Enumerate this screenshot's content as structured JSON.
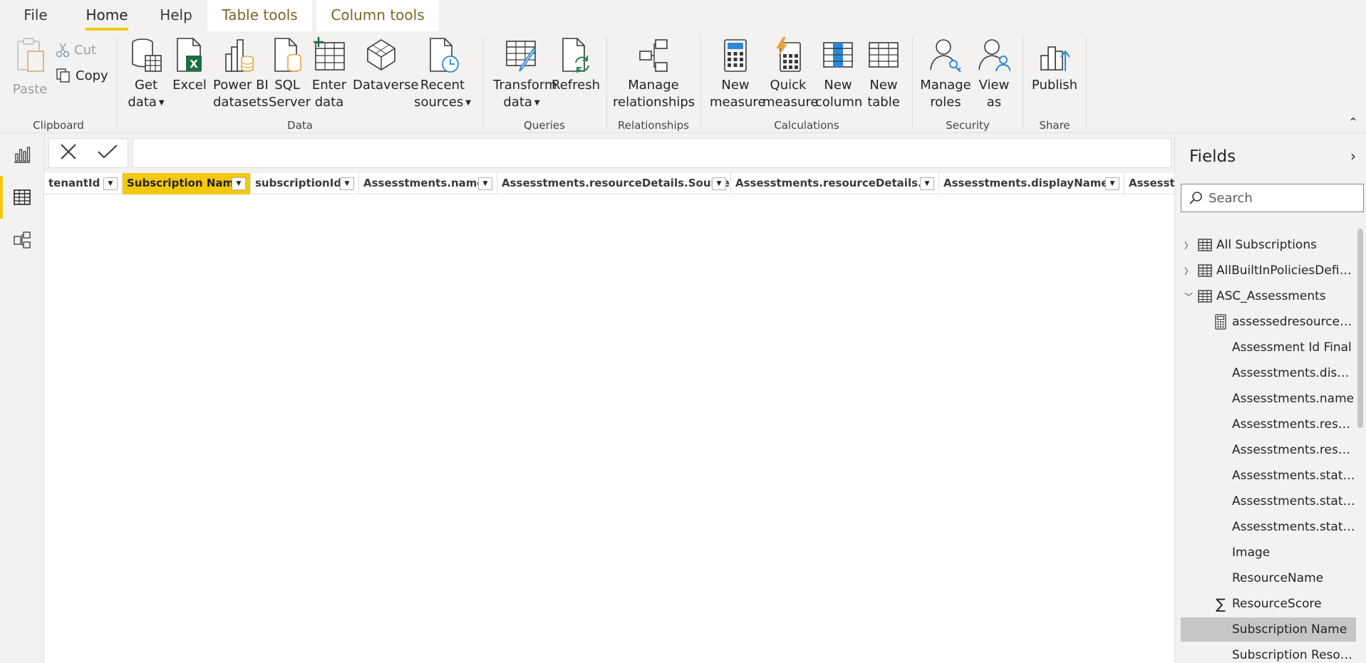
{
  "menu": {
    "file": "File",
    "home": "Home",
    "help": "Help",
    "table_tools": "Table tools",
    "column_tools": "Column tools"
  },
  "ribbon": {
    "clipboard": {
      "label": "Clipboard",
      "paste": "Paste",
      "cut": "Cut",
      "copy": "Copy"
    },
    "data": {
      "label": "Data",
      "get_data": [
        "Get",
        "data"
      ],
      "excel": [
        "Excel"
      ],
      "power_bi": [
        "Power BI",
        "datasets"
      ],
      "sql": [
        "SQL",
        "Server"
      ],
      "enter": [
        "Enter",
        "data"
      ],
      "dataverse": [
        "Dataverse"
      ],
      "recent": [
        "Recent",
        "sources"
      ]
    },
    "queries": {
      "label": "Queries",
      "transform": [
        "Transform",
        "data"
      ],
      "refresh": [
        "Refresh"
      ]
    },
    "relationships": {
      "label": "Relationships",
      "manage": [
        "Manage",
        "relationships"
      ]
    },
    "calculations": {
      "label": "Calculations",
      "new_measure": [
        "New",
        "measure"
      ],
      "quick_measure": [
        "Quick",
        "measure"
      ],
      "new_column": [
        "New",
        "column"
      ],
      "new_table": [
        "New",
        "table"
      ]
    },
    "security": {
      "label": "Security",
      "manage_roles": [
        "Manage",
        "roles"
      ],
      "view_as": [
        "View",
        "as"
      ]
    },
    "share": {
      "label": "Share",
      "publish": [
        "Publish"
      ]
    }
  },
  "formula": {
    "value": ""
  },
  "table": {
    "columns": [
      {
        "name": "tenantId",
        "selected": false
      },
      {
        "name": "Subscription Name",
        "selected": true
      },
      {
        "name": "subscriptionId",
        "selected": false
      },
      {
        "name": "Assesstments.name",
        "selected": false
      },
      {
        "name": "Assesstments.resourceDetails.Source",
        "selected": false
      },
      {
        "name": "Assesstments.resourceDetails.Id",
        "selected": false
      },
      {
        "name": "Assesstments.displayName",
        "selected": false
      },
      {
        "name": "Assesstme",
        "selected": false
      }
    ]
  },
  "fields": {
    "title": "Fields",
    "search_placeholder": "Search",
    "items": [
      {
        "text": "All Subscriptions",
        "kind": "table",
        "expand": "collapsed"
      },
      {
        "text": "AllBuiltInPoliciesDefini...",
        "kind": "table",
        "expand": "collapsed"
      },
      {
        "text": "ASC_Assessments",
        "kind": "table",
        "expand": "expanded"
      },
      {
        "text": "assessedresourcesc...",
        "kind": "calc"
      },
      {
        "text": "Assessment Id Final",
        "kind": "field"
      },
      {
        "text": "Assesstments.displ...",
        "kind": "field"
      },
      {
        "text": "Assesstments.name",
        "kind": "field"
      },
      {
        "text": "Assesstments.reso...",
        "kind": "field"
      },
      {
        "text": "Assesstments.reso...",
        "kind": "field"
      },
      {
        "text": "Assesstments.statu...",
        "kind": "field"
      },
      {
        "text": "Assesstments.statu...",
        "kind": "field"
      },
      {
        "text": "Assesstments.statu...",
        "kind": "field"
      },
      {
        "text": "Image",
        "kind": "field"
      },
      {
        "text": "ResourceName",
        "kind": "field"
      },
      {
        "text": "ResourceScore",
        "kind": "sum"
      },
      {
        "text": "Subscription Name",
        "kind": "field",
        "selected": true
      },
      {
        "text": "Subscription Resou...",
        "kind": "field"
      }
    ]
  },
  "colors": {
    "accent": "#f2c811",
    "excel_green": "#1d6f42",
    "blue_icon": "#2b88d8",
    "orange_icon": "#e8a33d",
    "contextual_text": "#7a6528"
  }
}
